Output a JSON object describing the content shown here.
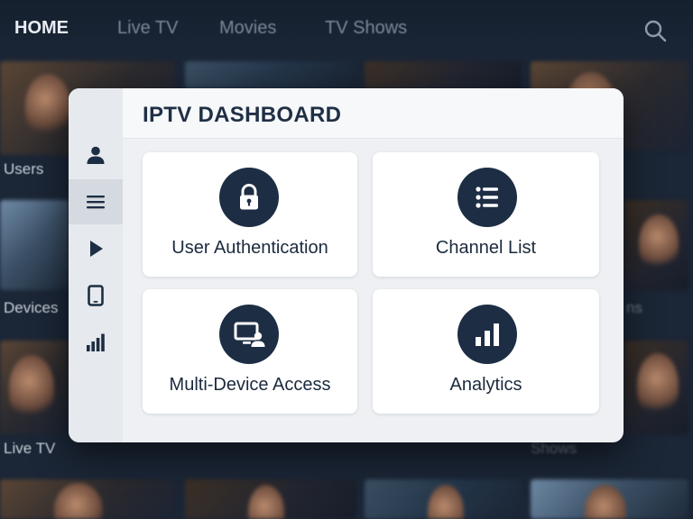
{
  "topnav": {
    "items": [
      {
        "label": "HOME",
        "active": true
      },
      {
        "label": "Live TV",
        "active": false
      },
      {
        "label": "Movies",
        "active": false
      },
      {
        "label": "TV Shows",
        "active": false
      }
    ],
    "search_icon": "search-icon"
  },
  "background": {
    "row_labels": [
      "Users",
      "Devices",
      "Live TV"
    ],
    "faint_labels": [
      "ns",
      "Shows"
    ]
  },
  "dashboard": {
    "title": "IPTV DASHBOARD",
    "sidebar": [
      {
        "icon": "user-icon",
        "active": false
      },
      {
        "icon": "menu-icon",
        "active": true
      },
      {
        "icon": "play-icon",
        "active": false
      },
      {
        "icon": "tablet-icon",
        "active": false
      },
      {
        "icon": "signal-bars-icon",
        "active": false
      }
    ],
    "tiles": [
      {
        "label": "User Authentication",
        "icon": "lock-icon"
      },
      {
        "label": "Channel List",
        "icon": "list-icon"
      },
      {
        "label": "Multi-Device Access",
        "icon": "monitor-user-icon"
      },
      {
        "label": "Analytics",
        "icon": "bar-chart-icon"
      }
    ]
  },
  "colors": {
    "icon_circle": "#1d2e44",
    "card_bg": "#eef0f3",
    "title": "#1f2f45"
  }
}
